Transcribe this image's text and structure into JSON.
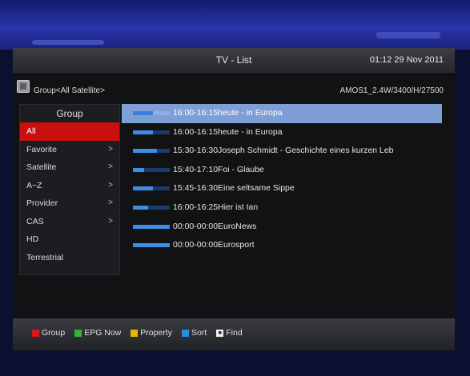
{
  "header": {
    "title": "TV - List",
    "clock": "01:12 29 Nov 2011"
  },
  "info": {
    "group_path": "Group<All Satellite>",
    "satellite": "AMOS1_2.4W/3400/H/27500"
  },
  "sidebar": {
    "header": "Group",
    "items": [
      {
        "label": "All",
        "chevron": ""
      },
      {
        "label": "Favorite",
        "chevron": ">"
      },
      {
        "label": "Satellite",
        "chevron": ">"
      },
      {
        "label": "A~Z",
        "chevron": ">"
      },
      {
        "label": "Provider",
        "chevron": ">"
      },
      {
        "label": "CAS",
        "chevron": ">"
      },
      {
        "label": "HD",
        "chevron": ""
      },
      {
        "label": "Terrestrial",
        "chevron": ""
      }
    ]
  },
  "channels": [
    {
      "time": "16:00-16:15",
      "name": "heute - in Europa",
      "progress": 0.55
    },
    {
      "time": "16:00-16:15",
      "name": "heute - in Europa",
      "progress": 0.55
    },
    {
      "time": "15:30-16:30",
      "name": "Joseph Schmidt - Geschichte eines kurzen Leb",
      "progress": 0.65
    },
    {
      "time": "15:40-17:10",
      "name": "Foi - Glaube",
      "progress": 0.3
    },
    {
      "time": "15:45-16:30",
      "name": "Eine seltsame Sippe",
      "progress": 0.55
    },
    {
      "time": "16:00-16:25",
      "name": "Hier ist Ian",
      "progress": 0.42
    },
    {
      "time": "00:00-00:00",
      "name": "EuroNews",
      "progress": 1.0
    },
    {
      "time": "00:00-00:00",
      "name": "Eurosport",
      "progress": 1.0
    }
  ],
  "footer": {
    "keys": [
      {
        "label": "Group",
        "color": "#d41a1a",
        "icon": "red-key-icon"
      },
      {
        "label": "EPG Now",
        "color": "#2fb82f",
        "icon": "green-key-icon"
      },
      {
        "label": "Property",
        "color": "#e8b800",
        "icon": "yellow-key-icon"
      },
      {
        "label": "Sort",
        "color": "#2a8ee0",
        "icon": "blue-key-icon"
      },
      {
        "label": "Find",
        "color": "#f0f0f0",
        "icon": "find-key-icon"
      }
    ]
  },
  "colors": {
    "selection_highlight": "#7e9ed6",
    "active_group": "#c81010",
    "progress_fill": "#3a8ee8"
  }
}
